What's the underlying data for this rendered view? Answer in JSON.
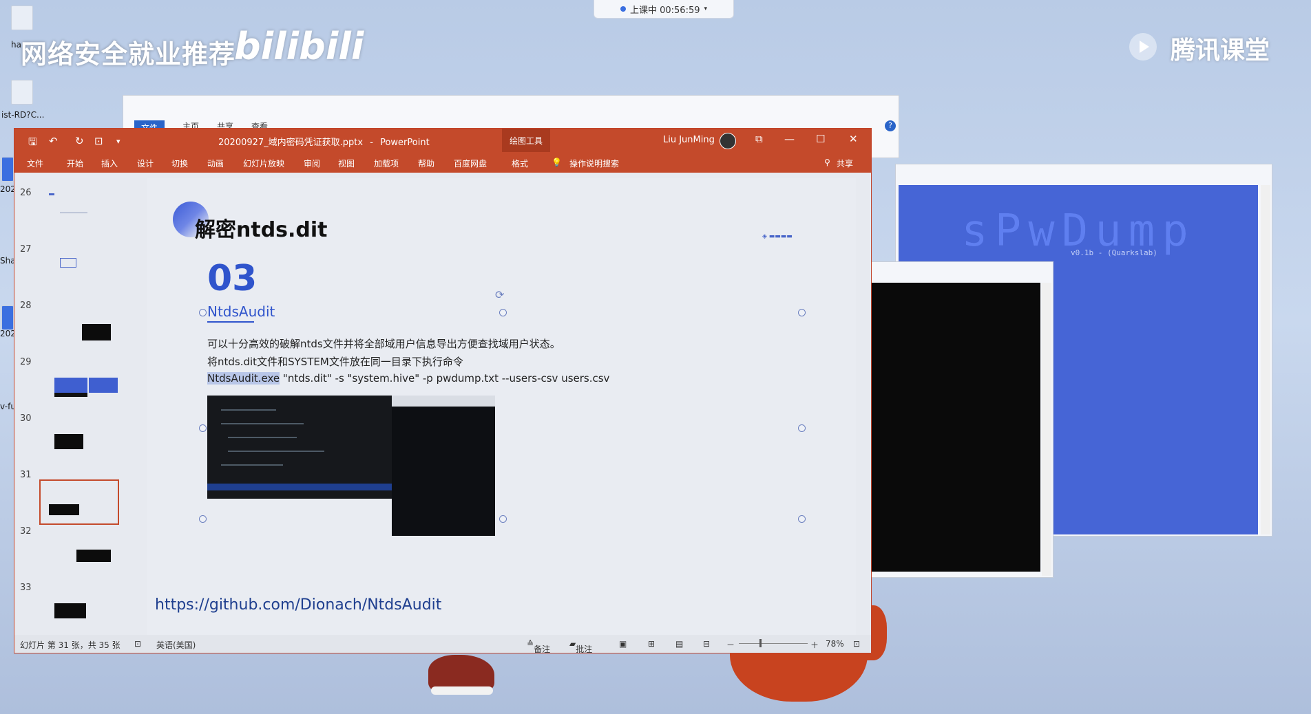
{
  "overlay": {
    "class_status": "上课中 00:56:59",
    "banner_text": "网络安全就业推荐",
    "bilibili_logo": "bilibili",
    "tencent_logo": "腾讯课堂"
  },
  "desktop_icons": [
    {
      "label": "ha"
    },
    {
      "label": "ist-RD?C..."
    },
    {
      "label": "202"
    },
    {
      "label": "Sha"
    },
    {
      "label": "202"
    },
    {
      "label": "v-fu"
    }
  ],
  "explorer": {
    "tabs": [
      "文件",
      "主页",
      "共享",
      "查看"
    ]
  },
  "terminal": {
    "art_text": "sPwDump",
    "subtitle": "v0.1b - (Quarkslab)"
  },
  "powerpoint": {
    "filename": "20200927_域内密码凭证获取.pptx",
    "separator": "-",
    "app_name": "PowerPoint",
    "context_tab": "绘图工具",
    "user_name": "Liu JunMing",
    "window_controls": {
      "ribbon_display": "⧉",
      "minimize": "—",
      "maximize": "☐",
      "close": "✕"
    },
    "ribbon_tabs": [
      "文件",
      "开始",
      "插入",
      "设计",
      "切换",
      "动画",
      "幻灯片放映",
      "审阅",
      "视图",
      "加载项",
      "帮助",
      "百度网盘",
      "格式"
    ],
    "tell_me": "操作说明搜索",
    "share": "共享"
  },
  "thumbnails": [
    {
      "num": "26"
    },
    {
      "num": "27"
    },
    {
      "num": "28"
    },
    {
      "num": "29"
    },
    {
      "num": "30"
    },
    {
      "num": "31",
      "selected": true
    },
    {
      "num": "32"
    },
    {
      "num": "33"
    }
  ],
  "slide": {
    "title": "解密ntds.dit",
    "number": "03",
    "subtitle": "NtdsAudit",
    "line1": "可以十分高效的破解ntds文件并将全部域用户信息导出方便查找域用户状态。",
    "line2": "将ntds.dit文件和SYSTEM文件放在同一目录下执行命令",
    "cmd_exe": "NtdsAudit.exe",
    "cmd_args": " \"ntds.dit\" -s \"system.hive\" -p pwdump.txt --users-csv users.csv",
    "link": "https://github.com/Dionach/NtdsAudit"
  },
  "status_bar": {
    "slide_info": "幻灯片 第 31 张，共 35 张",
    "language": "英语(美国)",
    "notes": "备注",
    "comments": "批注",
    "zoom": "78%",
    "zoom_minus": "－",
    "zoom_plus": "＋"
  }
}
